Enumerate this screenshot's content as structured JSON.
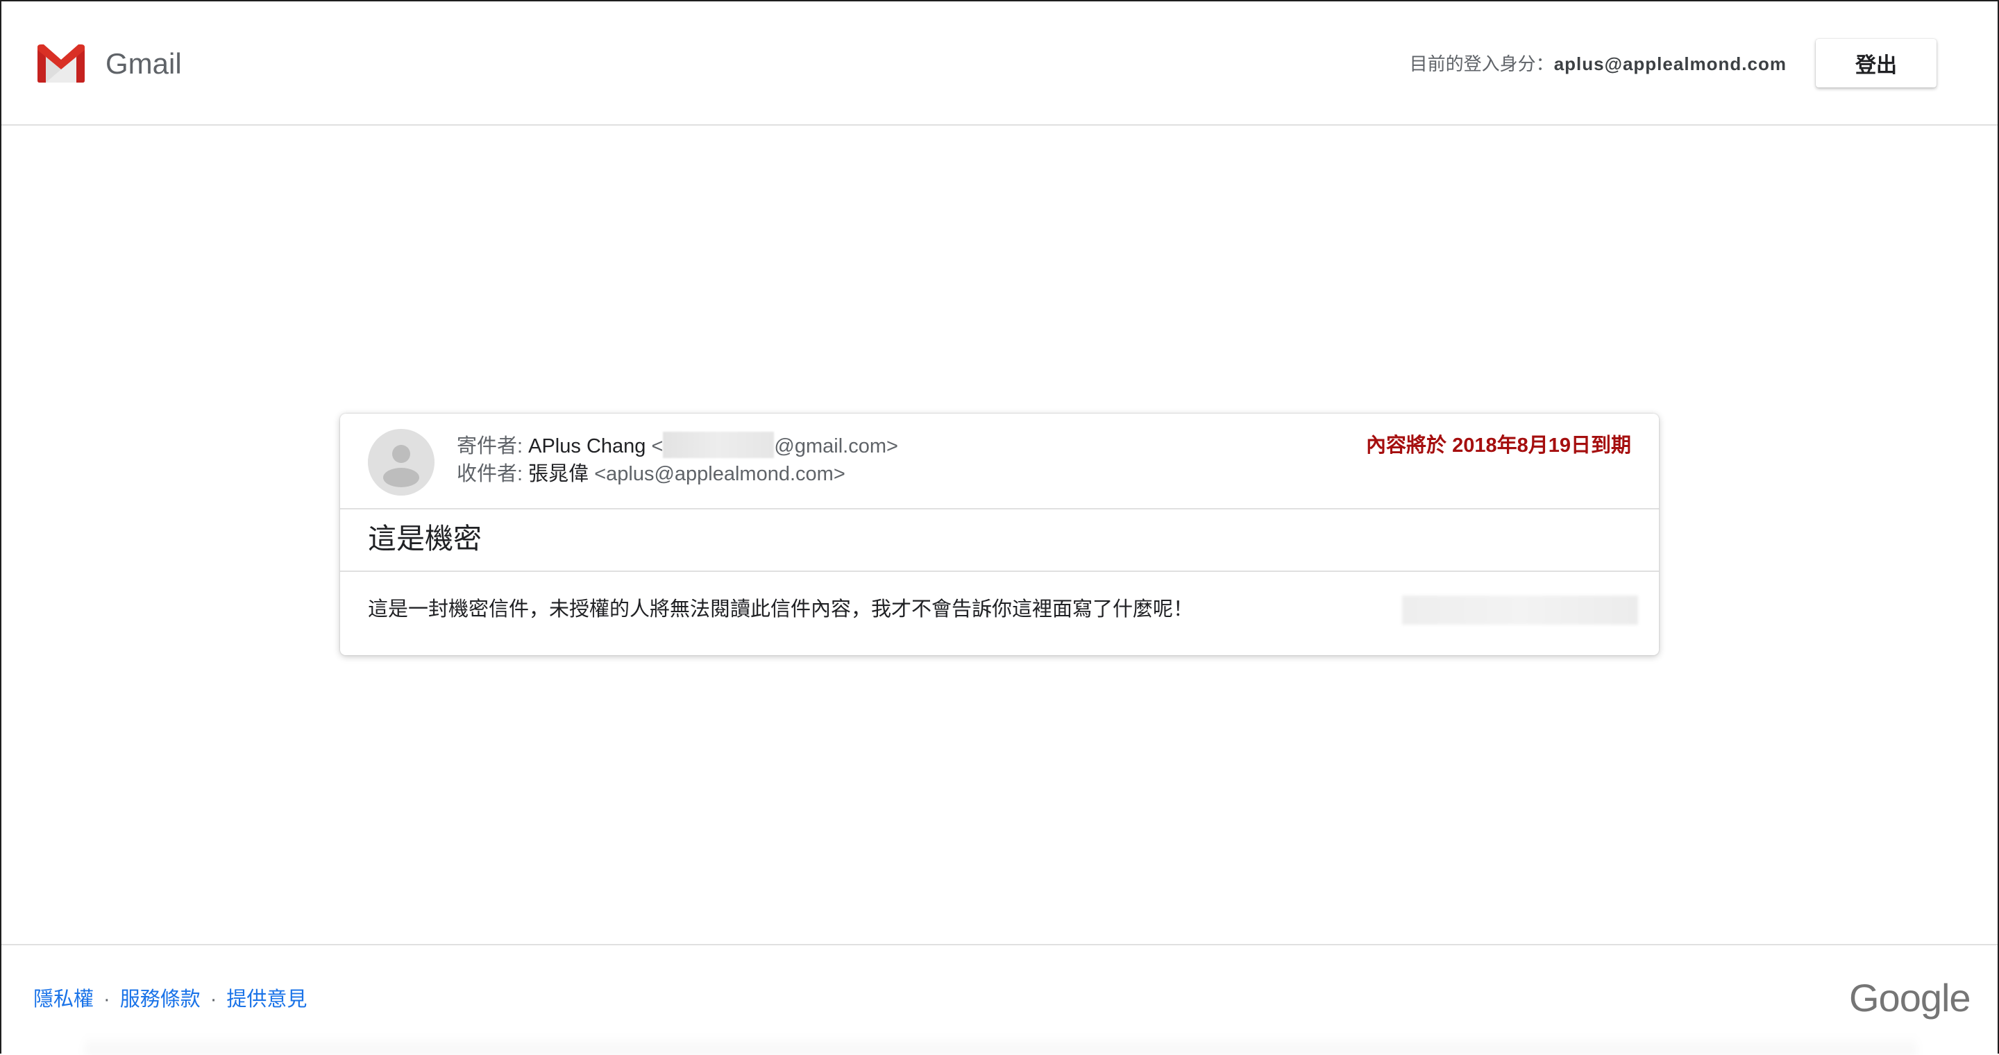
{
  "header": {
    "brand": "Gmail",
    "signed_in_label": "目前的登入身分：",
    "signed_in_account": "aplus@applealmond.com",
    "signout_label": "登出"
  },
  "message": {
    "from_label": "寄件者: ",
    "from_name": "APlus Chang",
    "from_email_open": " <",
    "from_email_suffix": "@gmail.com>",
    "to_label": "收件者: ",
    "to_name": "張晁偉",
    "to_email": " <aplus@applealmond.com>",
    "expiry": "內容將於 2018年8月19日到期",
    "subject": "這是機密",
    "body": "這是一封機密信件，未授權的人將無法閱讀此信件內容，我才不會告訴你這裡面寫了什麼呢！"
  },
  "footer": {
    "links": [
      "隱私權",
      "服務條款",
      "提供意見"
    ],
    "separator": "·",
    "google": "Google"
  },
  "colors": {
    "accent_link": "#1a73e8",
    "expiry_red": "#a50e0e",
    "gmail_red": "#d93025"
  },
  "icons": {
    "logo": "gmail-logo-icon",
    "avatar": "default-avatar-icon"
  }
}
